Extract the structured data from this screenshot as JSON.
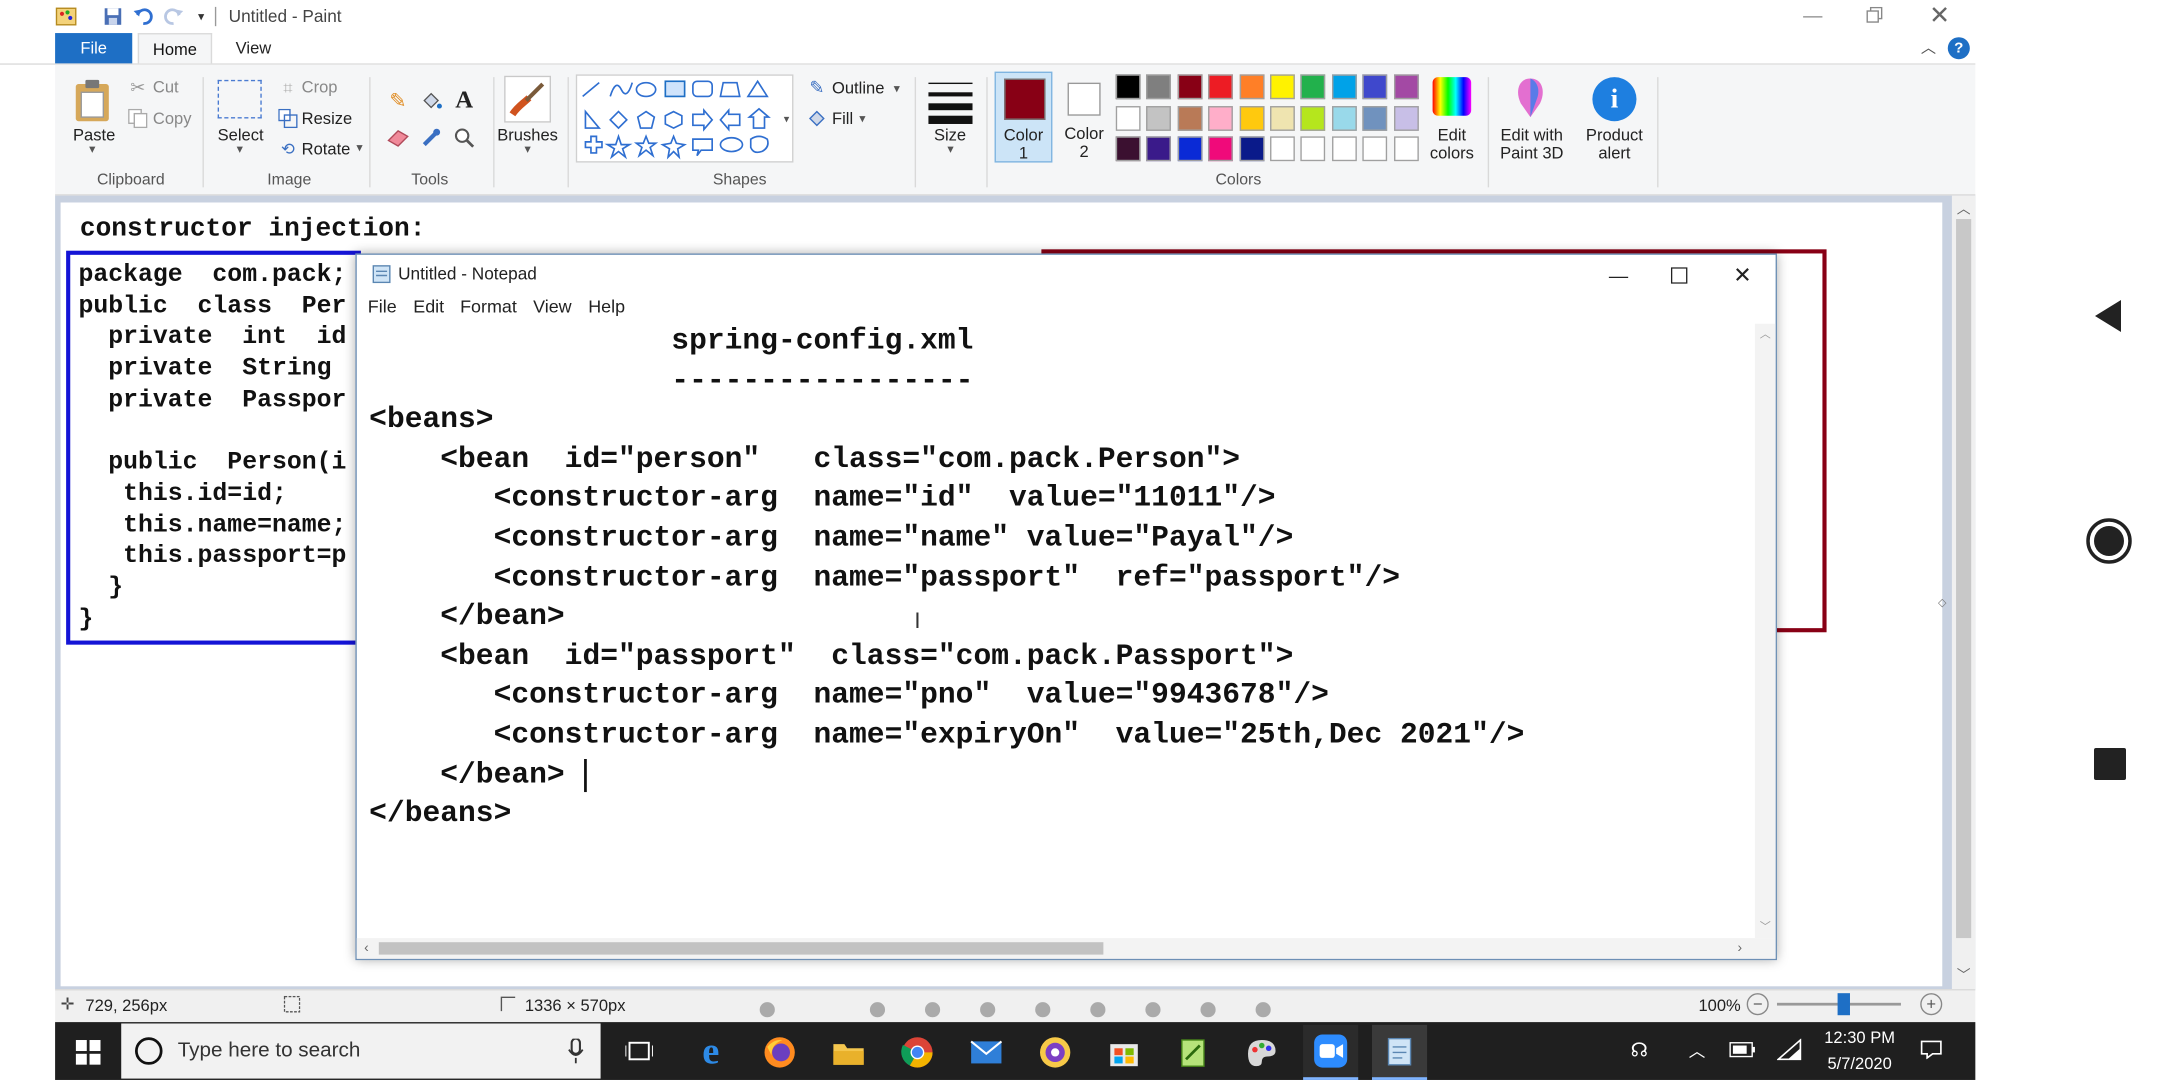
{
  "paint": {
    "title": "Untitled - Paint",
    "menu": {
      "file": "File",
      "home": "Home",
      "view": "View"
    },
    "clipboard": {
      "paste": "Paste",
      "cut": "Cut",
      "copy": "Copy",
      "group": "Clipboard"
    },
    "image": {
      "select": "Select",
      "crop": "Crop",
      "resize": "Resize",
      "rotate": "Rotate",
      "group": "Image"
    },
    "tools_group": "Tools",
    "brushes": "Brushes",
    "shapes": {
      "outline": "Outline",
      "fill": "Fill",
      "group": "Shapes"
    },
    "size": "Size",
    "color1": {
      "line1": "Color",
      "line2": "1"
    },
    "color2": {
      "line1": "Color",
      "line2": "2"
    },
    "colors_group": "Colors",
    "edit_colors": {
      "line1": "Edit",
      "line2": "colors"
    },
    "edit_3d": {
      "line1": "Edit with",
      "line2": "Paint 3D"
    },
    "product_alert": {
      "line1": "Product",
      "line2": "alert"
    },
    "status": {
      "cursor_pos": "729, 256px",
      "selection_size": "1336 × 570px",
      "zoom": "100%"
    },
    "canvas": {
      "heading": "constructor injection:",
      "java_lines": [
        "package  com.pack;",
        "public  class  Per",
        "  private  int  id",
        "  private  String",
        "  private  Passpor",
        "",
        "  public  Person(i",
        "   this.id=id;",
        "   this.name=name;",
        "   this.passport=p",
        "  }",
        "}"
      ]
    },
    "colors": {
      "color1": "#880015",
      "color2": "#ffffff",
      "palette_row1": [
        "#000000",
        "#7f7f7f",
        "#880015",
        "#ed1c24",
        "#ff7f27",
        "#fff200",
        "#22b14c",
        "#00a2e8",
        "#3f48cc",
        "#a349a4"
      ],
      "palette_row2": [
        "#ffffff",
        "#c3c3c3",
        "#b97a57",
        "#ffaec9",
        "#ffc90e",
        "#efe4b0",
        "#b5e61d",
        "#99d9ea",
        "#7092be",
        "#c8bfe7"
      ],
      "palette_row3": [
        "#3b1030",
        "#3a1a8a",
        "#0a2ad6",
        "#f00a7a",
        "#0a1a8a",
        "#ffffff",
        "#ffffff",
        "#ffffff",
        "#ffffff",
        "#ffffff"
      ]
    }
  },
  "notepad": {
    "title": "Untitled - Notepad",
    "menu": [
      "File",
      "Edit",
      "Format",
      "View",
      "Help"
    ],
    "lines": [
      "                 spring-config.xml",
      "                 -----------------",
      "<beans>",
      "    <bean  id=\"person\"   class=\"com.pack.Person\">",
      "       <constructor-arg  name=\"id\"  value=\"11011\"/>",
      "       <constructor-arg  name=\"name\" value=\"Payal\"/>",
      "       <constructor-arg  name=\"passport\"  ref=\"passport\"/>",
      "    </bean>",
      "    <bean  id=\"passport\"  class=\"com.pack.Passport\">",
      "       <constructor-arg  name=\"pno\"  value=\"9943678\"/>",
      "       <constructor-arg  name=\"expiryOn\"  value=\"25th,Dec 2021\"/>",
      "    </bean>",
      "</beans>"
    ]
  },
  "taskbar": {
    "search_placeholder": "Type here to search",
    "time": "12:30 PM",
    "date": "5/7/2020"
  },
  "icons": [
    "paint-app-icon",
    "save-icon",
    "undo-icon",
    "redo-icon",
    "minimize-icon",
    "restore-icon",
    "close-icon",
    "help-icon",
    "windows-start-icon",
    "cortana-icon",
    "task-view-icon",
    "edge-icon",
    "firefox-icon",
    "file-explorer-icon",
    "chrome-icon",
    "mail-icon",
    "store-icon",
    "zoom-app-icon",
    "notepad-icon",
    "back-nav-icon",
    "home-nav-icon",
    "recents-nav-icon"
  ]
}
